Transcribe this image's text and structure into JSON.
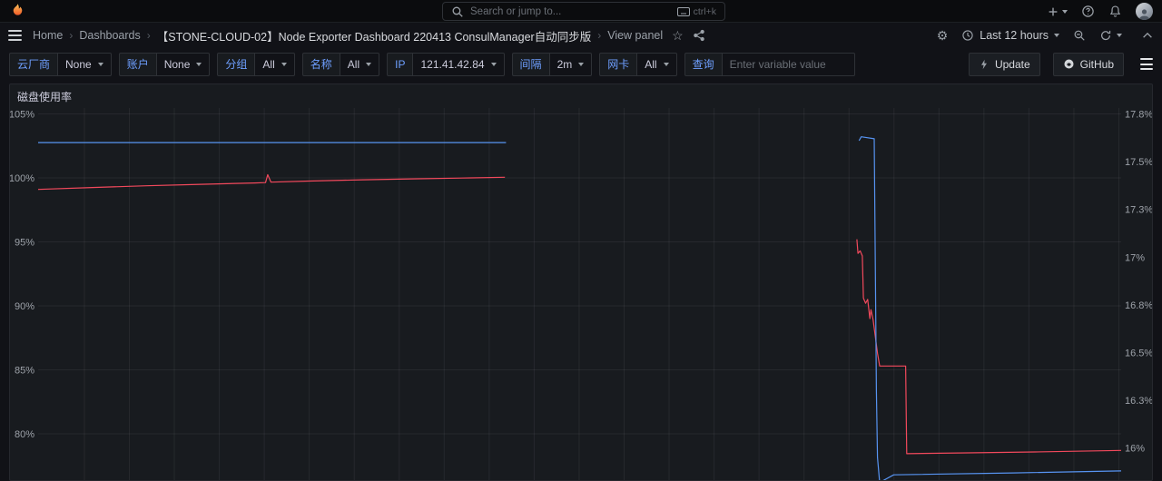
{
  "topnav": {
    "search_placeholder": "Search or jump to...",
    "shortcut_hint": "ctrl+k"
  },
  "breadcrumb": {
    "items": [
      "Home",
      "Dashboards",
      "【STONE-CLOUD-02】Node Exporter Dashboard 220413 ConsulManager自动同步版",
      "View panel"
    ]
  },
  "toolbar": {
    "time_range_label": "Last 12 hours",
    "update_label": "Update",
    "github_label": "GitHub"
  },
  "variables": [
    {
      "label": "云厂商",
      "value": "None"
    },
    {
      "label": "账户",
      "value": "None"
    },
    {
      "label": "分组",
      "value": "All"
    },
    {
      "label": "名称",
      "value": "All"
    },
    {
      "label": "IP",
      "value": "121.41.42.84"
    },
    {
      "label": "间隔",
      "value": "2m"
    },
    {
      "label": "网卡",
      "value": "All"
    },
    {
      "label": "查询",
      "placeholder": "Enter variable value"
    }
  ],
  "panel": {
    "title": "磁盘使用率"
  },
  "chart_data": {
    "type": "line",
    "title": "磁盘使用率",
    "time_range": "Last 12 hours",
    "legend": "none",
    "x_axis": {
      "tick_labels_visible": false,
      "gridline_count": 24
    },
    "y_left": {
      "unit": "percent",
      "top_value": 105,
      "tick_step": 5,
      "ticks": [
        "105%",
        "100%",
        "95%",
        "90%",
        "85%",
        "80%"
      ]
    },
    "y_right": {
      "unit": "percent",
      "top_value": 17.75,
      "tick_step": 0.25,
      "ticks": [
        "17.8%",
        "17.5%",
        "17.3%",
        "17%",
        "16.8%",
        "16.5%",
        "16.3%",
        "16%"
      ]
    },
    "series": [
      {
        "id": "disk-usage-left-axis",
        "axis": "left",
        "color": "#f2495c",
        "points": [
          [
            0.0,
            99.1
          ],
          [
            0.05,
            99.25
          ],
          [
            0.1,
            99.38
          ],
          [
            0.15,
            99.5
          ],
          [
            0.2,
            99.6
          ],
          [
            0.21,
            99.63
          ],
          [
            0.212,
            100.25
          ],
          [
            0.215,
            99.67
          ],
          [
            0.25,
            99.75
          ],
          [
            0.3,
            99.85
          ],
          [
            0.35,
            99.93
          ],
          [
            0.4,
            100.0
          ],
          [
            0.431,
            100.05
          ],
          null,
          [
            0.756,
            95.2
          ],
          [
            0.757,
            94.1
          ],
          [
            0.759,
            94.3
          ],
          [
            0.761,
            93.9
          ],
          [
            0.762,
            90.6
          ],
          [
            0.764,
            90.2
          ],
          [
            0.766,
            90.5
          ],
          [
            0.768,
            89.0
          ],
          [
            0.769,
            89.7
          ],
          [
            0.771,
            88.9
          ],
          [
            0.773,
            87.6
          ],
          [
            0.775,
            86.3
          ],
          [
            0.777,
            85.3
          ],
          [
            0.79,
            85.3
          ],
          [
            0.801,
            85.3
          ],
          [
            0.802,
            78.45
          ],
          [
            0.85,
            78.5
          ],
          [
            0.92,
            78.58
          ],
          [
            1.0,
            78.7
          ]
        ]
      },
      {
        "id": "disk-usage-right-axis",
        "axis": "right",
        "color": "#5794f2",
        "points": [
          [
            0.0,
            17.6
          ],
          [
            0.215,
            17.6
          ],
          [
            0.432,
            17.6
          ],
          null,
          [
            0.758,
            17.61
          ],
          [
            0.76,
            17.63
          ],
          [
            0.772,
            17.62
          ],
          [
            0.774,
            16.3
          ],
          [
            0.775,
            15.95
          ],
          [
            0.777,
            15.82
          ],
          [
            0.79,
            15.86
          ],
          [
            0.9,
            15.87
          ],
          [
            1.0,
            15.88
          ]
        ]
      }
    ]
  }
}
